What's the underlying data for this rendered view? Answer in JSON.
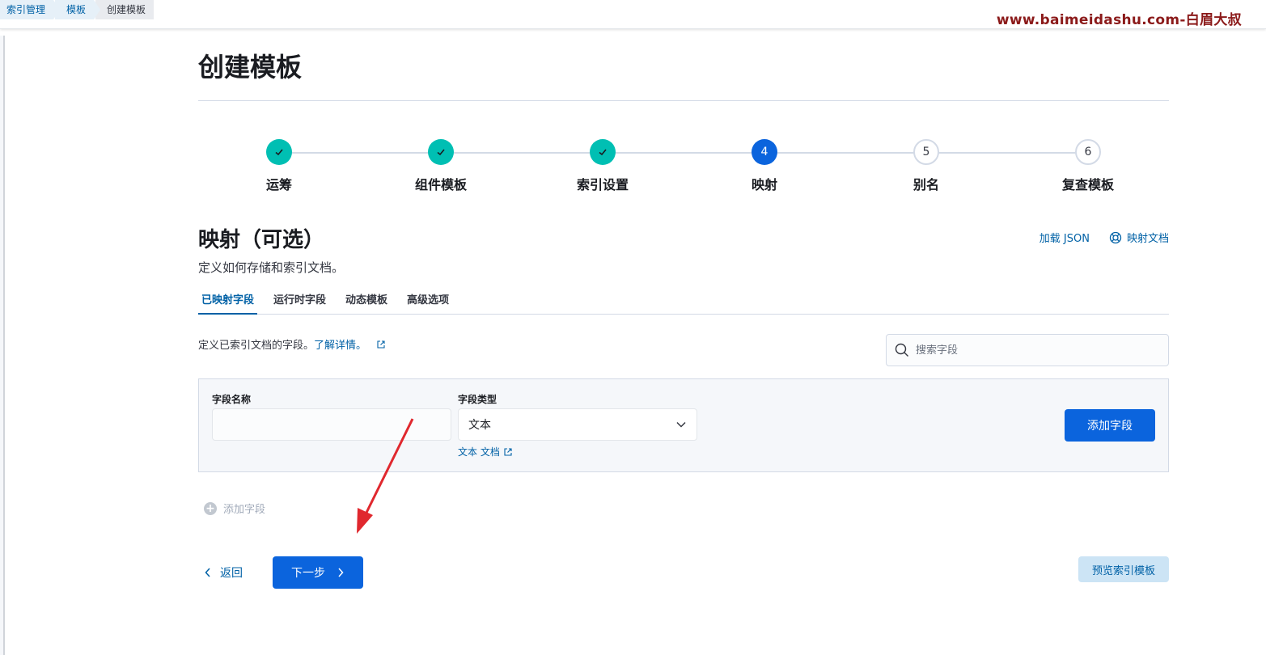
{
  "breadcrumbs": [
    "索引管理",
    "模板",
    "创建模板"
  ],
  "watermark": "www.baimeidashu.com-白眉大叔",
  "page_title": "创建模板",
  "steps": [
    {
      "label": "运筹",
      "status": "done",
      "number": "1"
    },
    {
      "label": "组件模板",
      "status": "done",
      "number": "2"
    },
    {
      "label": "索引设置",
      "status": "done",
      "number": "3"
    },
    {
      "label": "映射",
      "status": "current",
      "number": "4"
    },
    {
      "label": "别名",
      "status": "todo",
      "number": "5"
    },
    {
      "label": "复查模板",
      "status": "todo",
      "number": "6"
    }
  ],
  "section": {
    "title": "映射（可选）",
    "description": "定义如何存储和索引文档。",
    "load_json": "加载 JSON",
    "mapping_docs": "映射文档"
  },
  "tabs": [
    "已映射字段",
    "运行时字段",
    "动态模板",
    "高级选项"
  ],
  "active_tab": "已映射字段",
  "info": {
    "text": "定义已索引文档的字段。",
    "link": "了解详情。"
  },
  "search": {
    "placeholder": "搜索字段"
  },
  "field_form": {
    "name_label": "字段名称",
    "name_value": "",
    "type_label": "字段类型",
    "type_value": "文本",
    "type_doc_link": "文本 文档",
    "add_button": "添加字段"
  },
  "add_field_link": "添加字段",
  "footer": {
    "back": "返回",
    "next": "下一步",
    "preview": "预览索引模板"
  },
  "colors": {
    "primary": "#0b64dd",
    "link": "#0061a6",
    "done": "#00bfb3",
    "annotation_arrow": "#e0282e"
  }
}
